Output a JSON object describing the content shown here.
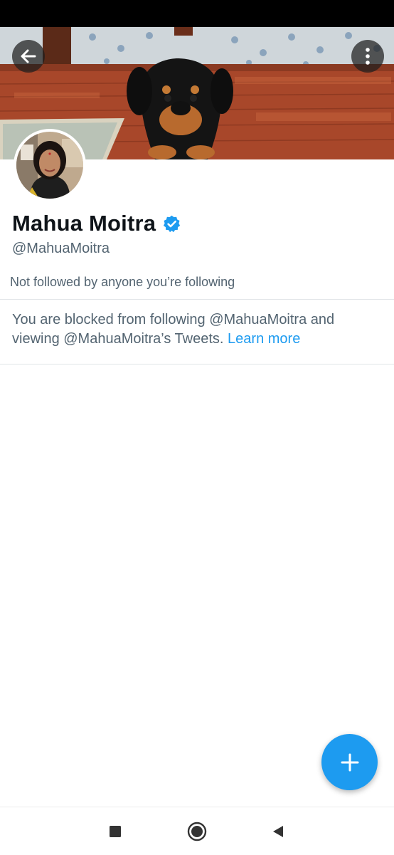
{
  "profile": {
    "display_name": "Mahua Moitra",
    "handle": "@MahuaMoitra",
    "followed_by": "Not followed by anyone you’re following"
  },
  "blocked": {
    "message": "You are blocked from following @MahuaMoitra and viewing @MahuaMoitra’s Tweets.",
    "link_label": "Learn more"
  },
  "icons": {
    "back": "arrow-left-icon",
    "more": "more-vertical-icon",
    "verified": "verified-badge-icon",
    "fab": "plus-icon",
    "nav": [
      "square-recents-icon",
      "circle-home-icon",
      "triangle-back-icon"
    ]
  },
  "colors": {
    "accent": "#1d9bf0",
    "text_primary": "#0f1419",
    "text_secondary": "#536471",
    "divider": "#e1e5e8"
  }
}
